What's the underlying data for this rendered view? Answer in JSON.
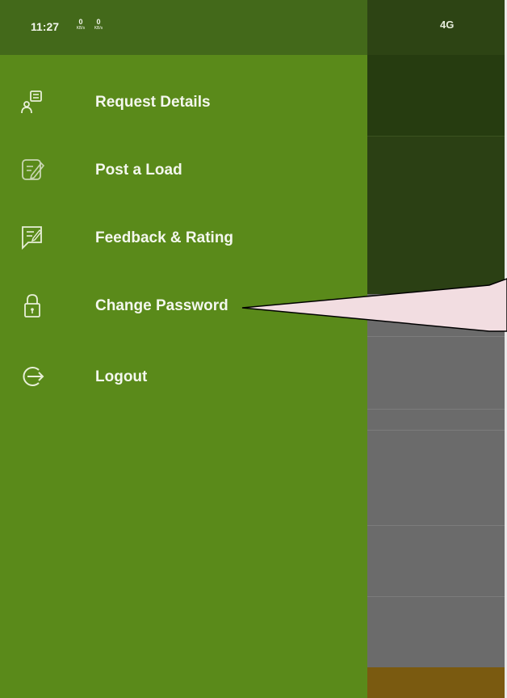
{
  "status_bar": {
    "time": "11:27",
    "speed_indicators": [
      {
        "value": "0",
        "unit": "KB/s"
      },
      {
        "value": "0",
        "unit": "KB/s"
      }
    ],
    "network": "4G"
  },
  "drawer": {
    "items": [
      {
        "label": "Request Details",
        "icon": "request-details-icon"
      },
      {
        "label": "Post a Load",
        "icon": "post-load-icon"
      },
      {
        "label": "Feedback & Rating",
        "icon": "feedback-icon"
      },
      {
        "label": "Change Password",
        "icon": "lock-icon"
      },
      {
        "label": "Logout",
        "icon": "logout-icon"
      }
    ]
  },
  "colors": {
    "drawer_background": "#5a8a1a",
    "status_bar": "#43691a",
    "callout_fill": "#f2dde1"
  }
}
